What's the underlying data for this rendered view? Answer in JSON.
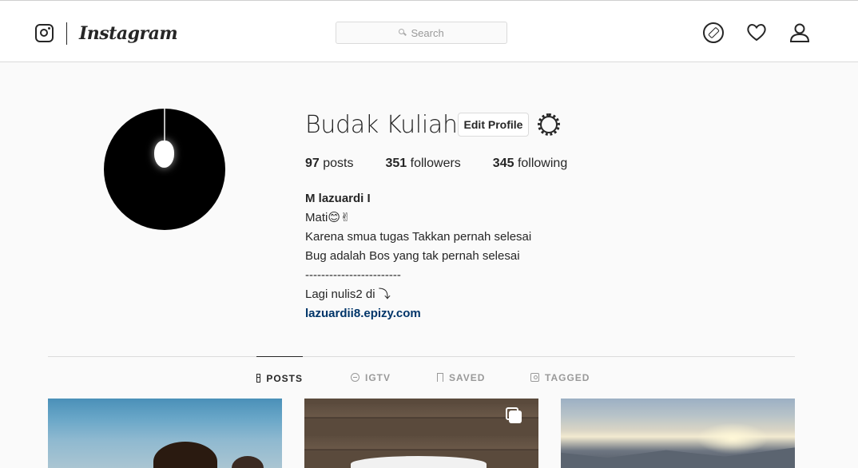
{
  "app": {
    "logo_text": "Instagram"
  },
  "search": {
    "placeholder": "Search"
  },
  "nav": {
    "icons": [
      "compass-icon",
      "heart-icon",
      "user-icon"
    ]
  },
  "profile": {
    "username": "Budak Kuliah",
    "edit_label": "Edit Profile",
    "stats": {
      "posts_count": "97",
      "posts_label": "posts",
      "followers_count": "351",
      "followers_label": "followers",
      "following_count": "345",
      "following_label": "following"
    },
    "bio": {
      "full_name": "M lazuardi I",
      "line1": "Mati😊✌",
      "line2": "Karena smua tugas Takkan pernah selesai",
      "line3": "Bug adalah Bos yang tak pernah selesai",
      "line4": "------------------------",
      "line5": "Lagi nulis2 di ⤵",
      "link": "lazuardii8.epizy.com"
    }
  },
  "tabs": [
    {
      "label": "POSTS",
      "active": true
    },
    {
      "label": "IGTV",
      "active": false
    },
    {
      "label": "SAVED",
      "active": false
    },
    {
      "label": "TAGGED",
      "active": false
    }
  ],
  "colors": {
    "link": "#003569",
    "border": "#dbdbdb",
    "background": "#fafafa"
  }
}
